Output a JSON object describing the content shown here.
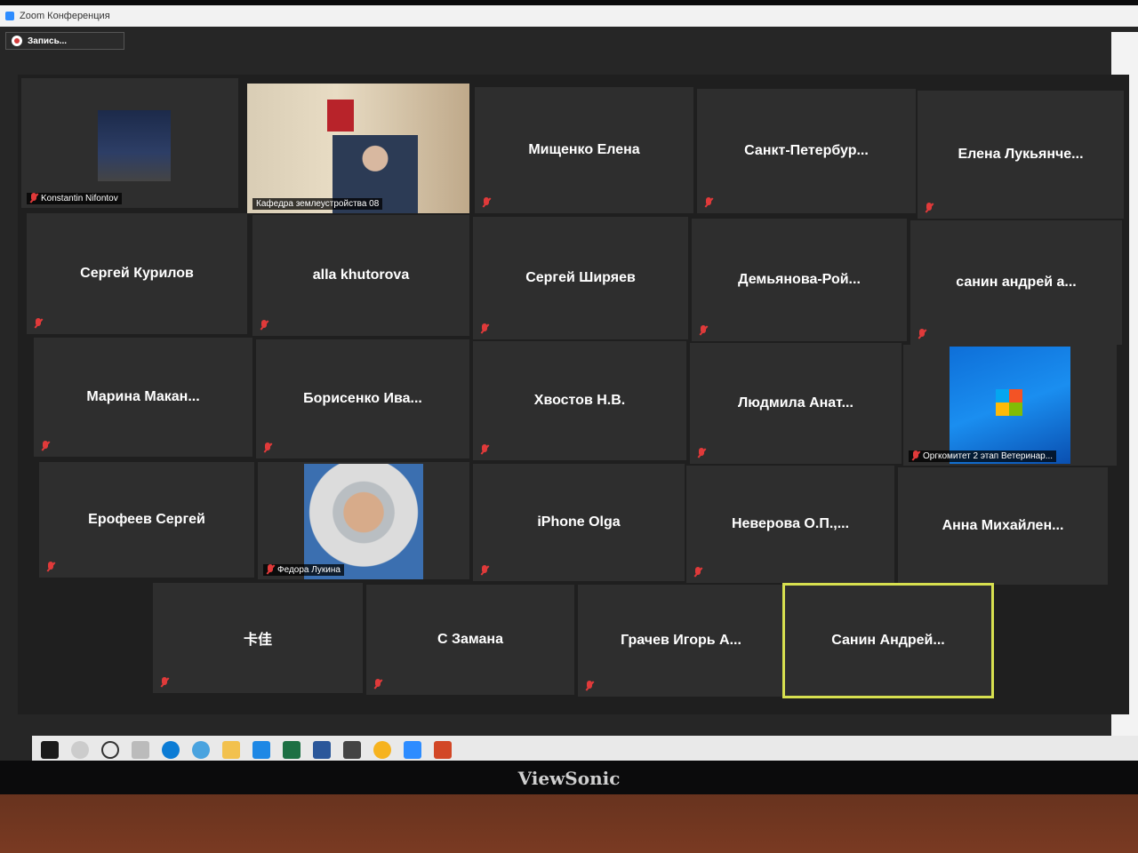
{
  "window": {
    "title": "Zoom Конференция"
  },
  "recording": {
    "label": "Запись..."
  },
  "participants": [
    {
      "name": "Konstantin Nifontov",
      "video": true
    },
    {
      "name": "Кафедра землеустройства 08",
      "video": true
    },
    {
      "name": "Мищенко Елена",
      "video": false
    },
    {
      "name": "Санкт-Петербур...",
      "video": false
    },
    {
      "name": "Елена  Лукьянче...",
      "video": false
    },
    {
      "name": "Сергей Курилов",
      "video": false
    },
    {
      "name": "alla khutorova",
      "video": false
    },
    {
      "name": "Сергей Ширяев",
      "video": false
    },
    {
      "name": "Демьянова-Рой...",
      "video": false
    },
    {
      "name": "санин андрей а...",
      "video": false
    },
    {
      "name": "Марина  Макан...",
      "video": false
    },
    {
      "name": "Борисенко  Ива...",
      "video": false
    },
    {
      "name": "Хвостов Н.В.",
      "video": false
    },
    {
      "name": "Людмила  Анат...",
      "video": false
    },
    {
      "name": "Оргкомитет 2 этап Ветеринар...",
      "video": true
    },
    {
      "name": "Ерофеев Сергей",
      "video": false
    },
    {
      "name": "Федора Лукина",
      "video": true
    },
    {
      "name": "iPhone Olga",
      "video": false
    },
    {
      "name": "Неверова О.П.,...",
      "video": false
    },
    {
      "name": "Анна  Михайлен...",
      "video": false
    },
    {
      "name": "卡佳",
      "video": false
    },
    {
      "name": "С Замана",
      "video": false
    },
    {
      "name": "Грачев Игорь А...",
      "video": false
    },
    {
      "name": "Санин  Андрей...",
      "video": false,
      "active_speaker": true
    }
  ],
  "monitor": {
    "brand": "ViewSonic"
  },
  "colors": {
    "active_border": "#d7e04f",
    "muted": "#e03a3a",
    "tile": "#2e2e2e"
  }
}
